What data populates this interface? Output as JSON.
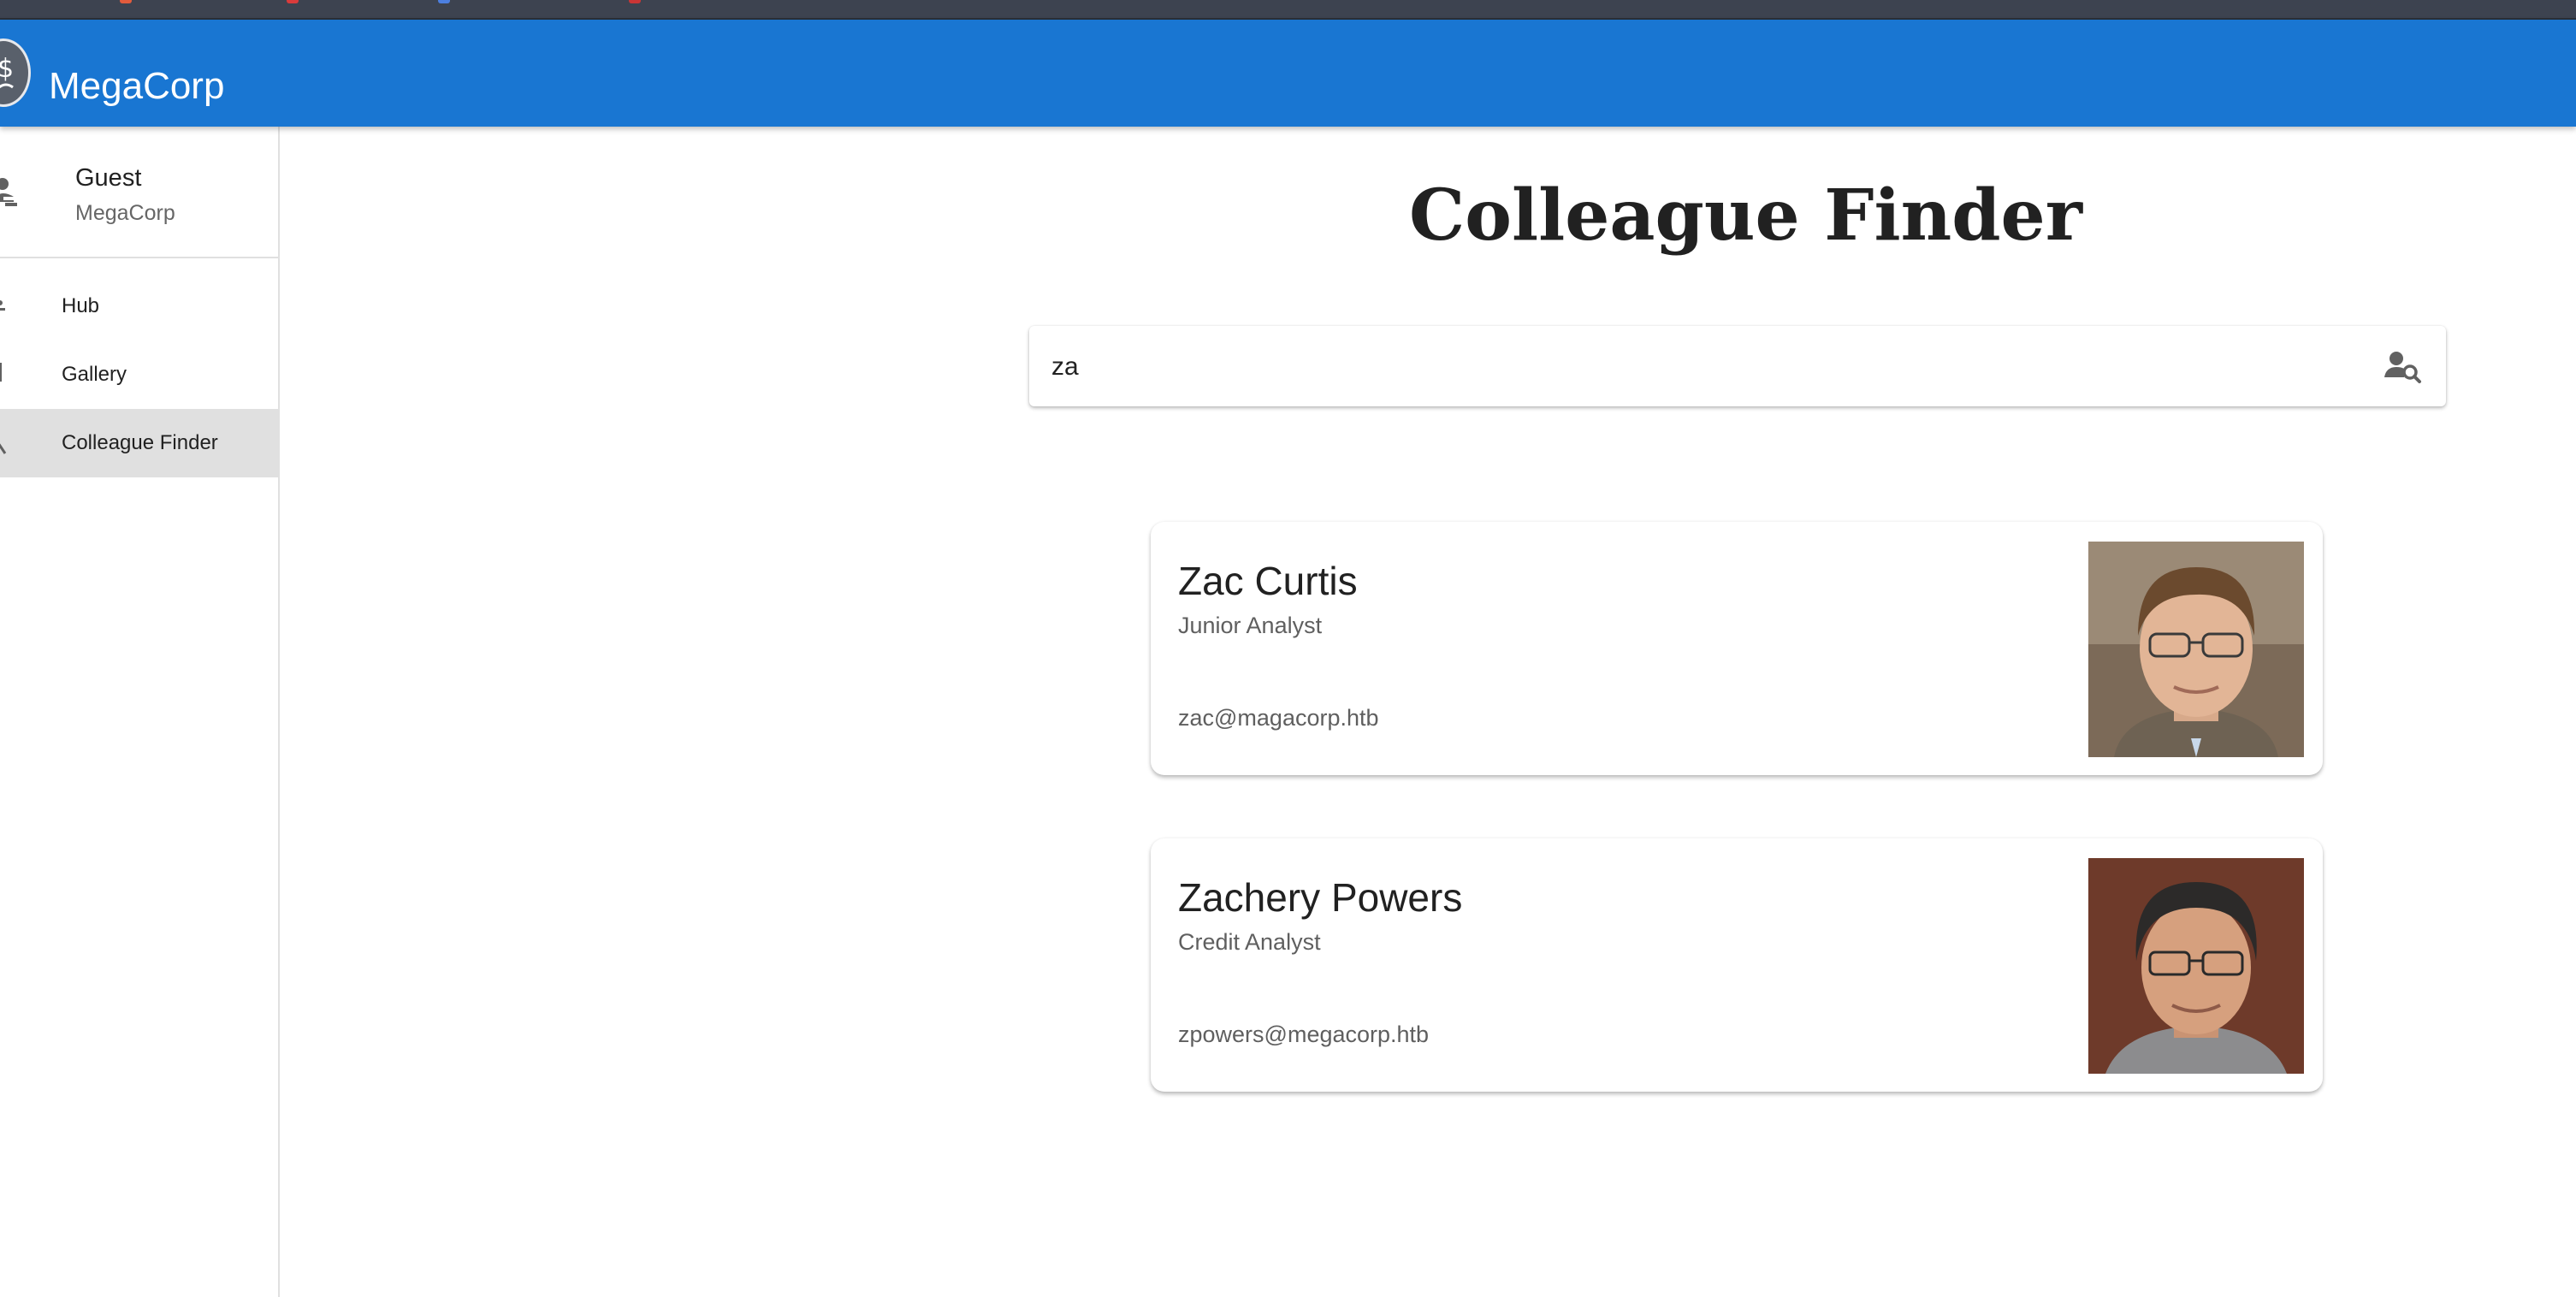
{
  "app": {
    "title": "MegaCorp",
    "brand_color": "#1976d2"
  },
  "user": {
    "name": "Guest",
    "org": "MegaCorp"
  },
  "nav": {
    "items": [
      {
        "label": "Hub",
        "icon": "hub-icon",
        "active": false
      },
      {
        "label": "Gallery",
        "icon": "gallery-icon",
        "active": false
      },
      {
        "label": "Colleague Finder",
        "icon": "search-icon",
        "active": true
      }
    ]
  },
  "page": {
    "title": "Colleague Finder"
  },
  "search": {
    "value": "za",
    "icon": "person-search-icon"
  },
  "results": [
    {
      "name": "Zac Curtis",
      "title": "Junior Analyst",
      "email": "zac@magacorp.htb"
    },
    {
      "name": "Zachery Powers",
      "title": "Credit Analyst",
      "email": "zpowers@megacorp.htb"
    }
  ]
}
